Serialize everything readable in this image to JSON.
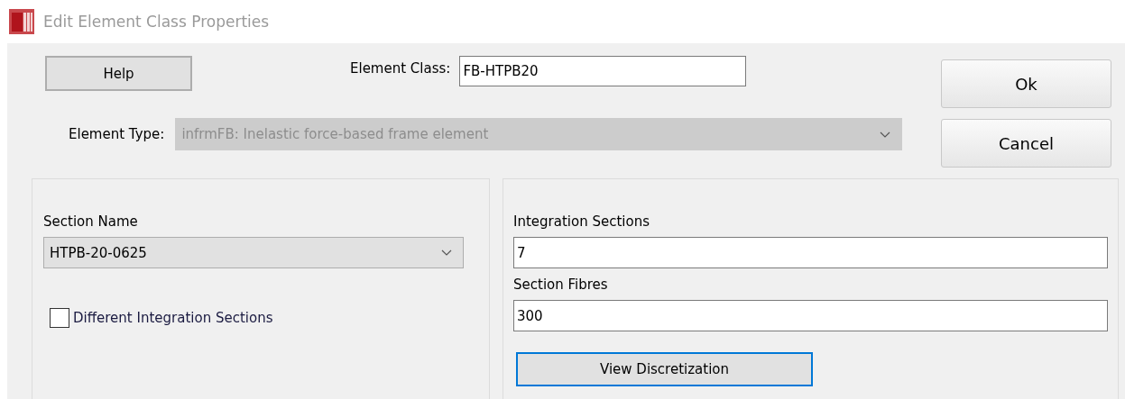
{
  "window": {
    "title": "Edit Element Class Properties"
  },
  "help_button": "Help",
  "element_class": {
    "label": "Element Class:",
    "value": "FB-HTPB20"
  },
  "element_type": {
    "label": "Element Type:",
    "value": "infrmFB: Inelastic force-based frame element",
    "disabled": true
  },
  "buttons": [
    {
      "label": "Ok",
      "focused": false
    },
    {
      "label": "Cancel",
      "focused": false
    }
  ],
  "section_name": {
    "label": "Section Name",
    "value": "HTPB-20-0625"
  },
  "different_integration_sections": {
    "label": "Different Integration Sections",
    "checked": false
  },
  "integration_sections": {
    "label": "Integration Sections",
    "value": "7"
  },
  "section_fibres": {
    "label": "Section Fibres",
    "value": "300"
  },
  "view_button": {
    "label": "View Discretization",
    "focused": true
  }
}
